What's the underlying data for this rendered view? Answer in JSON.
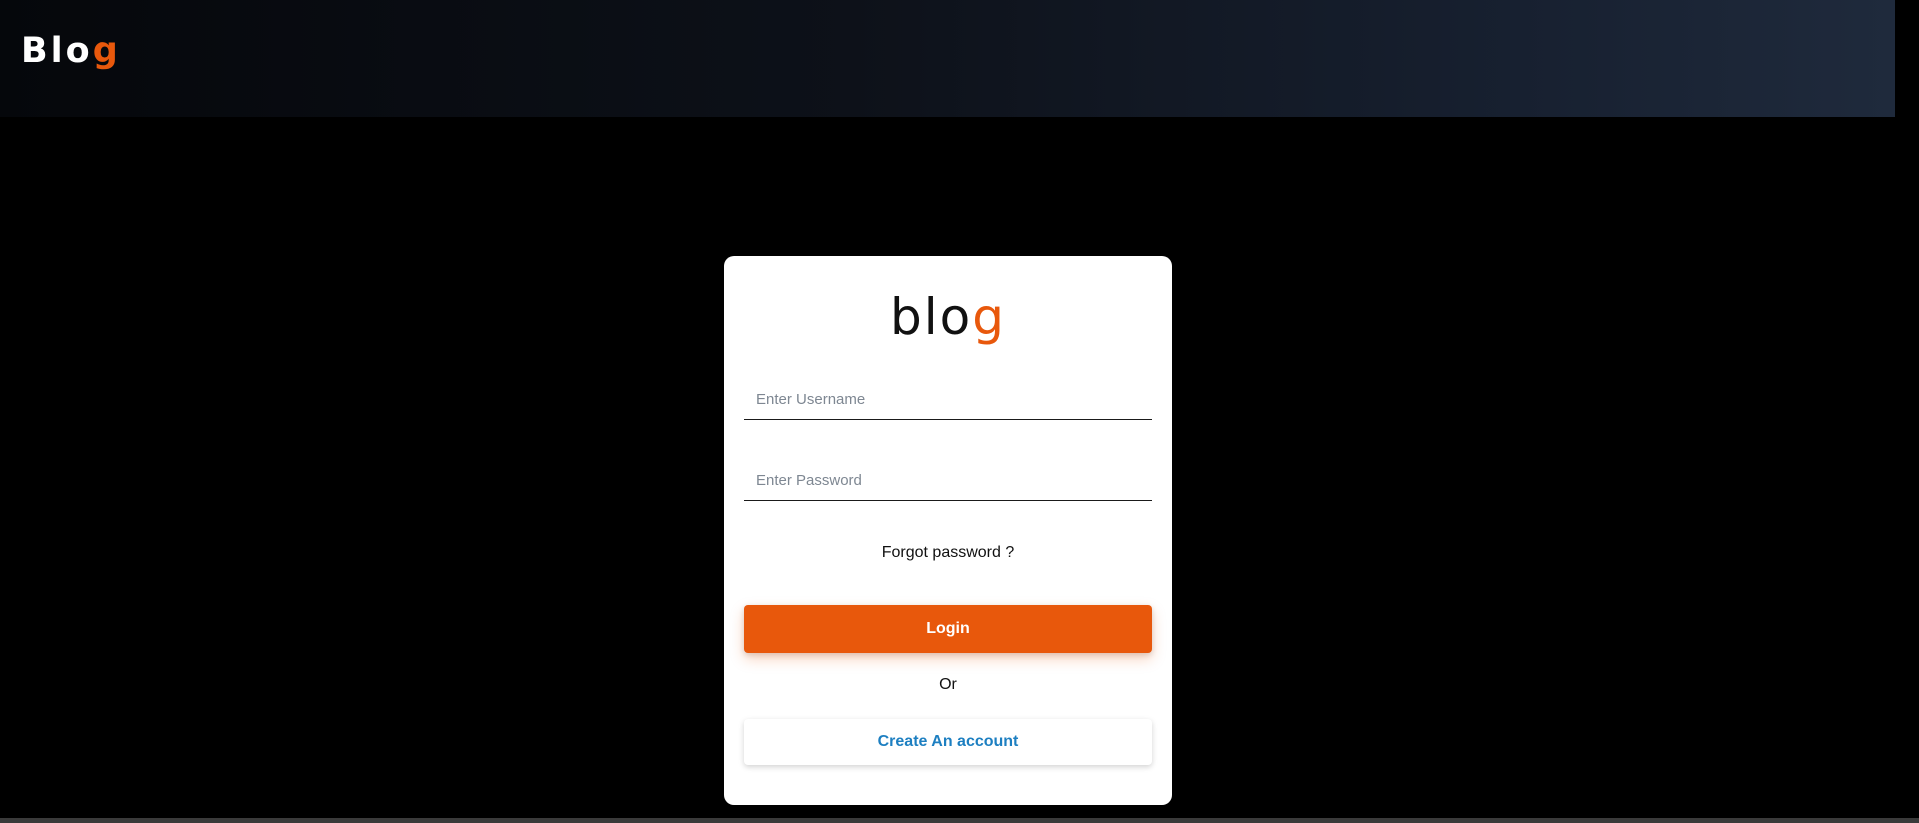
{
  "header": {
    "brand_main": "Blo",
    "brand_accent": "g"
  },
  "login_card": {
    "logo_main": "blo",
    "logo_accent": "g",
    "username_placeholder": "Enter Username",
    "password_placeholder": "Enter Password",
    "forgot_password": "Forgot password ?",
    "login_label": "Login",
    "or_label": "Or",
    "create_account_label": "Create An account"
  },
  "colors": {
    "accent": "#e8580c",
    "link": "#1d7fc1",
    "background": "#000000",
    "card": "#ffffff"
  }
}
